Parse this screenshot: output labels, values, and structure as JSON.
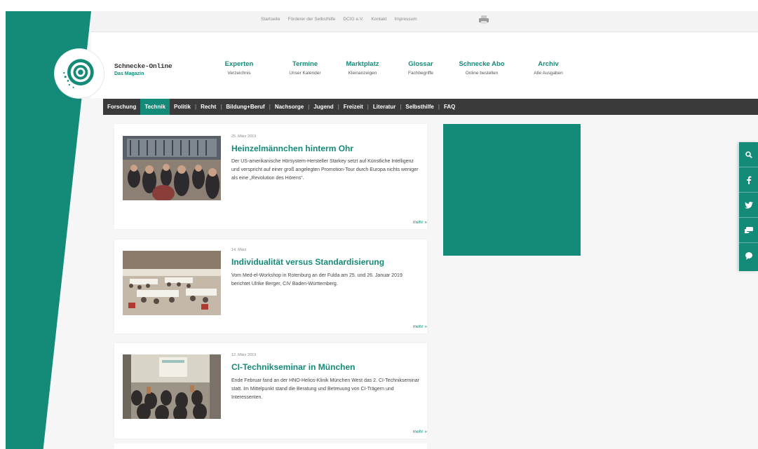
{
  "utility_links": [
    "Startseite",
    "Förderer der Selbsthilfe",
    "DCIG e.V.",
    "Kontakt",
    "Impressum"
  ],
  "brand": {
    "title": "Schnecke-Online",
    "subtitle": "Das Magazin"
  },
  "main_nav": [
    {
      "title": "Experten",
      "subtitle": "Verzeichnis"
    },
    {
      "title": "Termine",
      "subtitle": "Unser Kalender"
    },
    {
      "title": "Marktplatz",
      "subtitle": "Kleinanzeigen"
    },
    {
      "title": "Glossar",
      "subtitle": "Fachbegriffe"
    },
    {
      "title": "Schnecke Abo",
      "subtitle": "Online bestellen"
    },
    {
      "title": "Archiv",
      "subtitle": "Alle Ausgaben"
    }
  ],
  "categories": [
    "Forschung",
    "Technik",
    "Politik",
    "Recht",
    "Bildung+Beruf",
    "Nachsorge",
    "Jugend",
    "Freizeit",
    "Literatur",
    "Selbsthilfe",
    "FAQ"
  ],
  "active_category": "Technik",
  "articles": [
    {
      "date": "25. März 2019",
      "title": "Heinzelmännchen hinterm Ohr",
      "body": "Der US-amerikanische Hörsystem-Hersteller Starkey setzt auf Künstliche Intelligenz und verspricht auf einer groß angelegten Promotion-Tour durch Europa nichts weniger als eine „Revolution des Hörens“.",
      "more": "mehr »"
    },
    {
      "date": "14. März",
      "title": "Individualität versus Standardisierung",
      "body": "Vom Med-el-Workshop in Rotenburg an der Fulda am 25. und 26. Januar 2019 berichtet Ulrike Berger, CIV Baden-Württemberg.",
      "more": "mehr »"
    },
    {
      "date": "12. März 2019",
      "title": "CI-Technikseminar in München",
      "body": "Ende Februar fand an der HNO-Helios-Klinik München West das 2. CI-Technikseminar statt. Im Mittelpunkt stand die Beratung und Betreuung von CI-Trägern und Interessenten.",
      "more": "mehr »"
    }
  ],
  "social_rail": [
    "search-icon",
    "facebook-icon",
    "twitter-icon",
    "chat-icon",
    "speech-bubble-icon"
  ],
  "colors": {
    "teal": "#148a78",
    "dark_bar": "#3a3a3a"
  }
}
